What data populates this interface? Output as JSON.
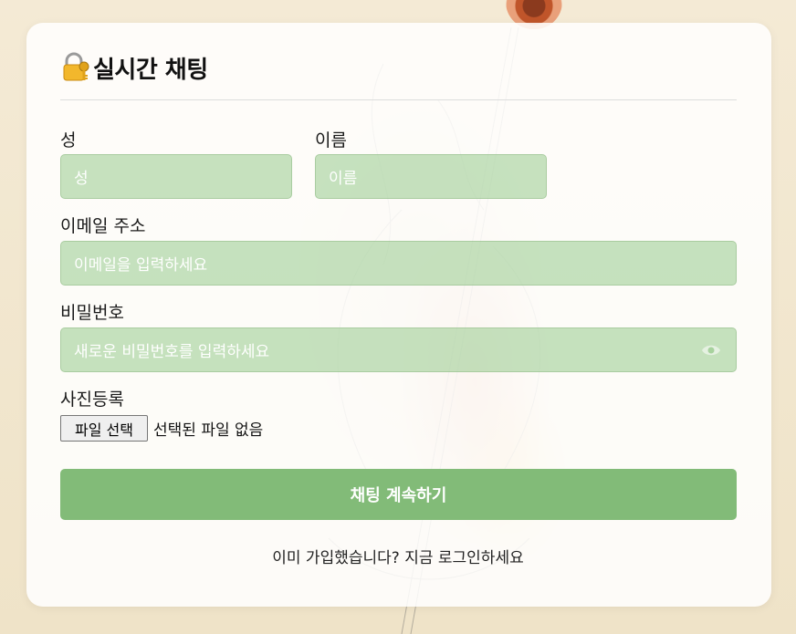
{
  "header": {
    "title": "실시간 채팅",
    "icon": "lock-with-key-icon"
  },
  "form": {
    "last_name": {
      "label": "성",
      "placeholder": "성"
    },
    "first_name": {
      "label": "이름",
      "placeholder": "이름"
    },
    "email": {
      "label": "이메일 주소",
      "placeholder": "이메일을 입력하세요"
    },
    "password": {
      "label": "비밀번호",
      "placeholder": "새로운 비밀번호를 입력하세요",
      "toggle_icon": "eye-icon"
    },
    "photo": {
      "label": "사진등록",
      "button_label": "파일 선택",
      "status": "선택된 파일 없음"
    },
    "submit_label": "채팅 계속하기"
  },
  "footer": {
    "prefix": "이미 가입했습니다?",
    "link": "지금 로그인하세요"
  },
  "colors": {
    "input_bg": "#a0ce96",
    "button_bg": "#82bb78",
    "card_bg": "#ffffff"
  }
}
